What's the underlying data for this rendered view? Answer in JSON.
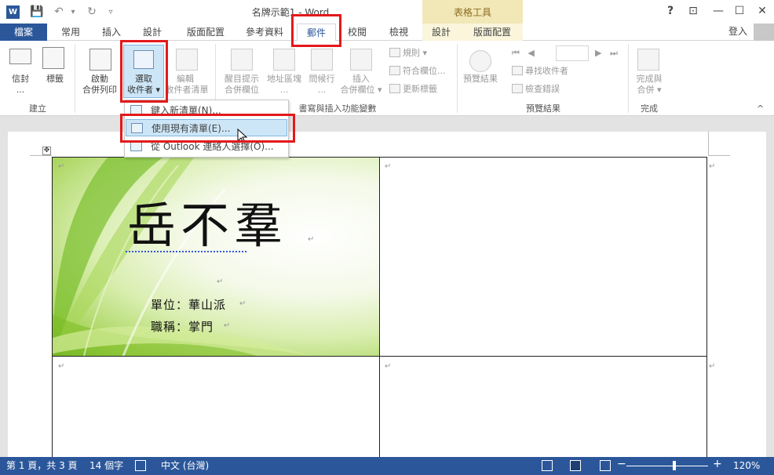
{
  "titlebar": {
    "doc_title": "名牌示範1 - Word",
    "contextual_header": "表格工具",
    "help": "?",
    "ribbon_display": "⊡",
    "minimize": "—",
    "maximize": "☐",
    "close": "✕"
  },
  "quick_access": {
    "save": "💾",
    "undo": "↶",
    "undo_dropdown": "▾",
    "redo": "↻",
    "customize": "▿"
  },
  "tabs": {
    "file": "檔案",
    "home": "常用",
    "insert": "插入",
    "design": "設計",
    "layout": "版面配置",
    "references": "參考資料",
    "mailings": "郵件",
    "review": "校閱",
    "view": "檢視",
    "table_design": "設計",
    "table_layout": "版面配置"
  },
  "signin": "登入",
  "ribbon": {
    "envelopes": "信封",
    "envelopes_sub": "...",
    "labels": "標籤",
    "group_create": "建立",
    "start_merge_1": "啟動",
    "start_merge_2": "合併列印",
    "select_recipients_1": "選取",
    "select_recipients_2": "收件者 ▾",
    "edit_list_1": "編輯",
    "edit_list_2": "收件者清單",
    "highlight_fields_1": "醒目提示",
    "highlight_fields_2": "合併欄位",
    "address_block_1": "地址區塊",
    "address_block_2": "...",
    "greeting_line_1": "問候行",
    "greeting_line_2": "...",
    "insert_field_1": "插入",
    "insert_field_2": "合併欄位 ▾",
    "rules": "規則 ▾",
    "match_fields": "符合欄位...",
    "update_labels": "更新標籤",
    "group_write_insert": "書寫與插入功能變數",
    "preview_results": "預覽結果",
    "find_recipient": "尋找收件者",
    "check_errors": "檢查錯誤",
    "group_preview": "預覽結果",
    "finish_merge_1": "完成與",
    "finish_merge_2": "合併 ▾",
    "group_finish": "完成",
    "collapse": "^"
  },
  "recipient_menu": {
    "items": [
      "鍵入新清單(N)...",
      "使用現有清單(E)...",
      "從 Outlook 連絡人選擇(O)..."
    ]
  },
  "document": {
    "card_name": "岳不羣",
    "card_unit": "單位：華山派",
    "card_title": "職稱：掌門",
    "paragraph_mark": "↵",
    "table_handle": "✥"
  },
  "statusbar": {
    "page": "第 1 頁，共 3 頁",
    "words": "14 個字",
    "language": "中文 (台灣)",
    "zoom_minus": "−",
    "zoom_plus": "+",
    "zoom": "120%"
  },
  "colors": {
    "accent": "#2b579a",
    "highlight": "#cde6f7",
    "annotation": "#e3191b",
    "table_tools": "#f2e7b7"
  }
}
